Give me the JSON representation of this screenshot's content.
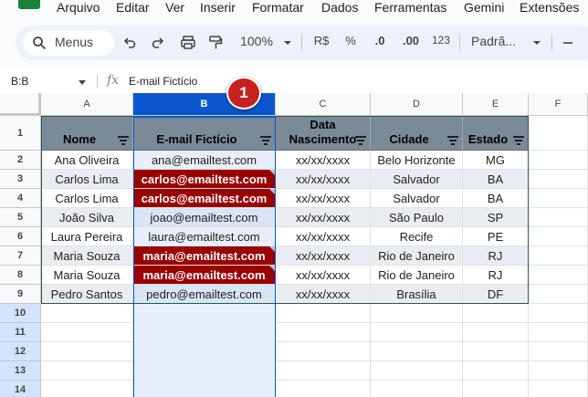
{
  "menu": [
    "Arquivo",
    "Editar",
    "Ver",
    "Inserir",
    "Formatar",
    "Dados",
    "Ferramentas",
    "Gemini",
    "Extensões"
  ],
  "toolbar": {
    "search_label": "Menus",
    "zoom": "100%",
    "currency": "R$",
    "percent": "%",
    "decrease_decimals": ".0",
    "increase_decimals": ".00",
    "number_format": "123",
    "font": "Padrã..."
  },
  "formula_bar": {
    "name_box": "B:B",
    "fx": "fx",
    "content": "E-mail Fictício"
  },
  "callout": "1",
  "columns": [
    "A",
    "B",
    "C",
    "D",
    "E",
    "F"
  ],
  "rows": [
    "1",
    "2",
    "3",
    "4",
    "5",
    "6",
    "7",
    "8",
    "9",
    "10",
    "11",
    "12",
    "13",
    "14"
  ],
  "headers": [
    "Nome",
    "E-mail Fictício",
    "Data\nNascimento",
    "Cidade",
    "Estado"
  ],
  "table_rows": [
    {
      "nome": "Ana Oliveira",
      "email": "ana@emailtest.com",
      "data": "xx/xx/xxxx",
      "cidade": "Belo Horizonte",
      "estado": "MG",
      "dup": false
    },
    {
      "nome": "Carlos Lima",
      "email": "carlos@emailtest.com",
      "data": "xx/xx/xxxx",
      "cidade": "Salvador",
      "estado": "BA",
      "dup": true
    },
    {
      "nome": "Carlos Lima",
      "email": "carlos@emailtest.com",
      "data": "xx/xx/xxxx",
      "cidade": "Salvador",
      "estado": "BA",
      "dup": true
    },
    {
      "nome": "João Silva",
      "email": "joao@emailtest.com",
      "data": "xx/xx/xxxx",
      "cidade": "São Paulo",
      "estado": "SP",
      "dup": false
    },
    {
      "nome": "Laura Pereira",
      "email": "laura@emailtest.com",
      "data": "xx/xx/xxxx",
      "cidade": "Recife",
      "estado": "PE",
      "dup": false
    },
    {
      "nome": "Maria Souza",
      "email": "maria@emailtest.com",
      "data": "xx/xx/xxxx",
      "cidade": "Rio de Janeiro",
      "estado": "RJ",
      "dup": true
    },
    {
      "nome": "Maria Souza",
      "email": "maria@emailtest.com",
      "data": "xx/xx/xxxx",
      "cidade": "Rio de Janeiro",
      "estado": "RJ",
      "dup": true
    },
    {
      "nome": "Pedro Santos",
      "email": "pedro@emailtest.com",
      "data": "xx/xx/xxxx",
      "cidade": "Brasília",
      "estado": "DF",
      "dup": false
    }
  ],
  "colors": {
    "duplicate_fill": "#990000",
    "header_fill": "#7a8a99",
    "selected_column": "#0b57d0",
    "selected_column_fill": "#e8effb",
    "callout": "#c5221f"
  }
}
